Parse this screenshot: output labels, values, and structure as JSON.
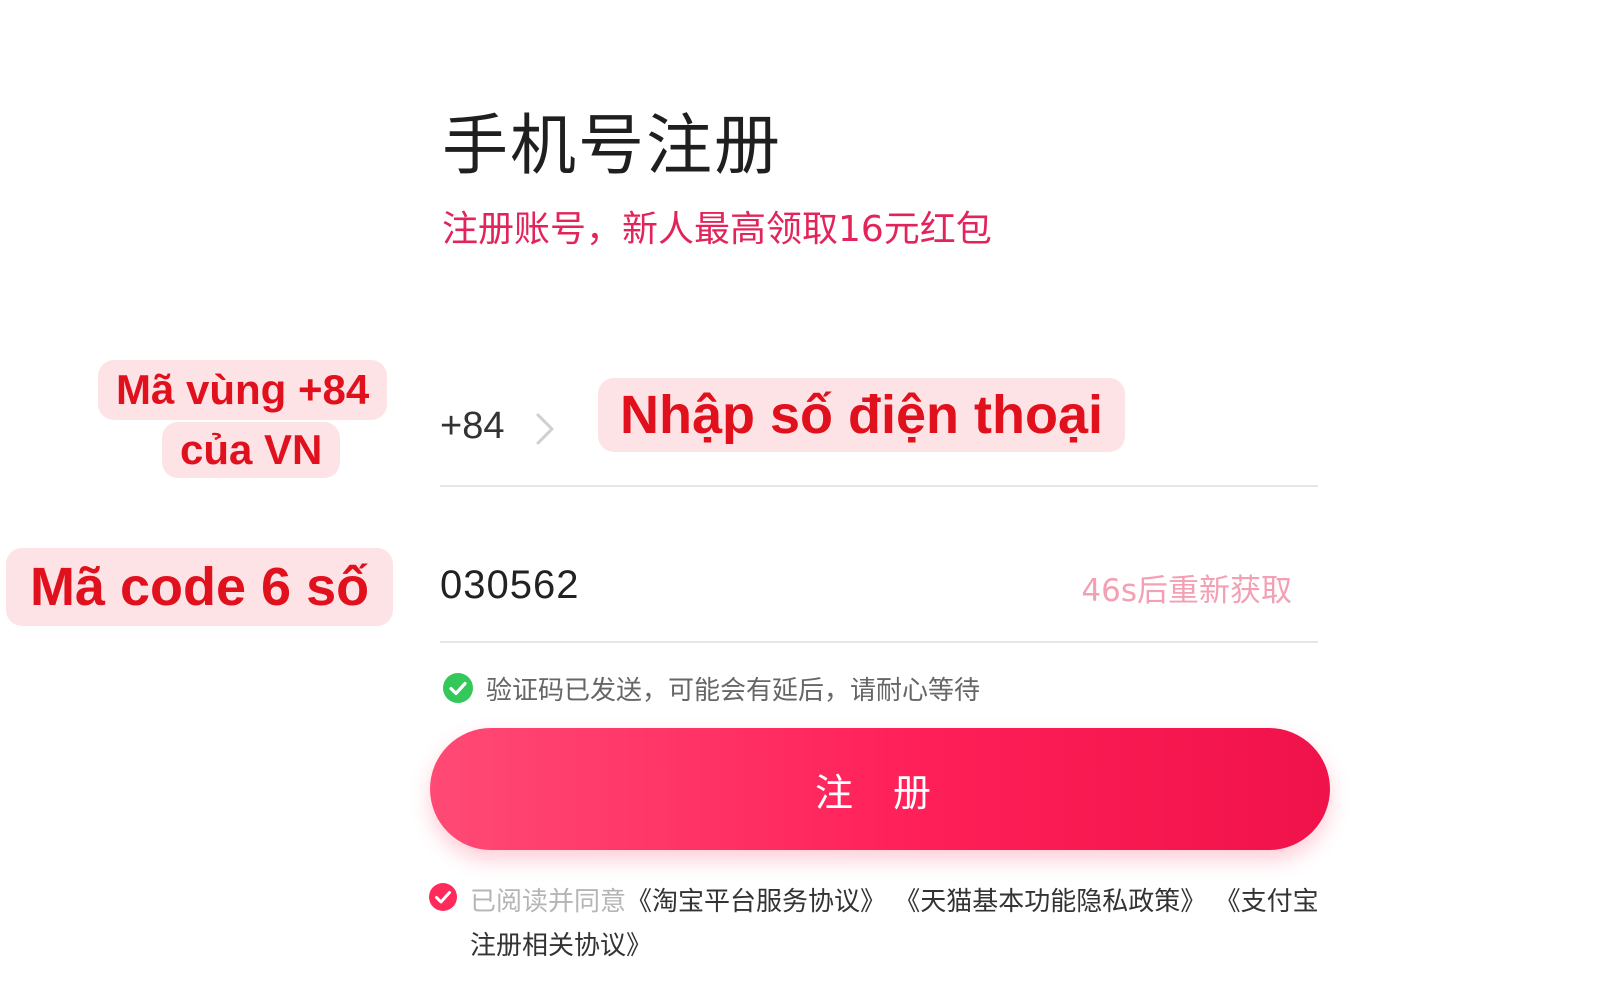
{
  "header": {
    "title": "手机号注册",
    "subtitle": "注册账号，新人最高领取16元红包"
  },
  "annotations": {
    "area_code_line1": "Mã vùng +84",
    "area_code_line2": "của VN",
    "phone_hint": "Nhập số điện thoại",
    "code_hint": "Mã code 6 số"
  },
  "form": {
    "country_code": "+84",
    "verification_code": "030562",
    "resend_label": "46s后重新获取",
    "sent_message": "验证码已发送，可能会有延后，请耐心等待",
    "register_label": "注 册"
  },
  "agreement": {
    "prefix": "已阅读并同意",
    "link_1": "《淘宝平台服务协议》",
    "link_2": "《天猫基本功能隐私政策》",
    "link_3": "《支付宝注册相关协议》"
  },
  "colors": {
    "accent": "#ff2a5c",
    "annotation_text": "#e0101c",
    "annotation_bg": "#fde3e6",
    "success": "#34c759"
  },
  "icons": {
    "chevron": "chevron-right-icon",
    "success": "check-circle-icon",
    "agree": "checked-radio-icon"
  }
}
